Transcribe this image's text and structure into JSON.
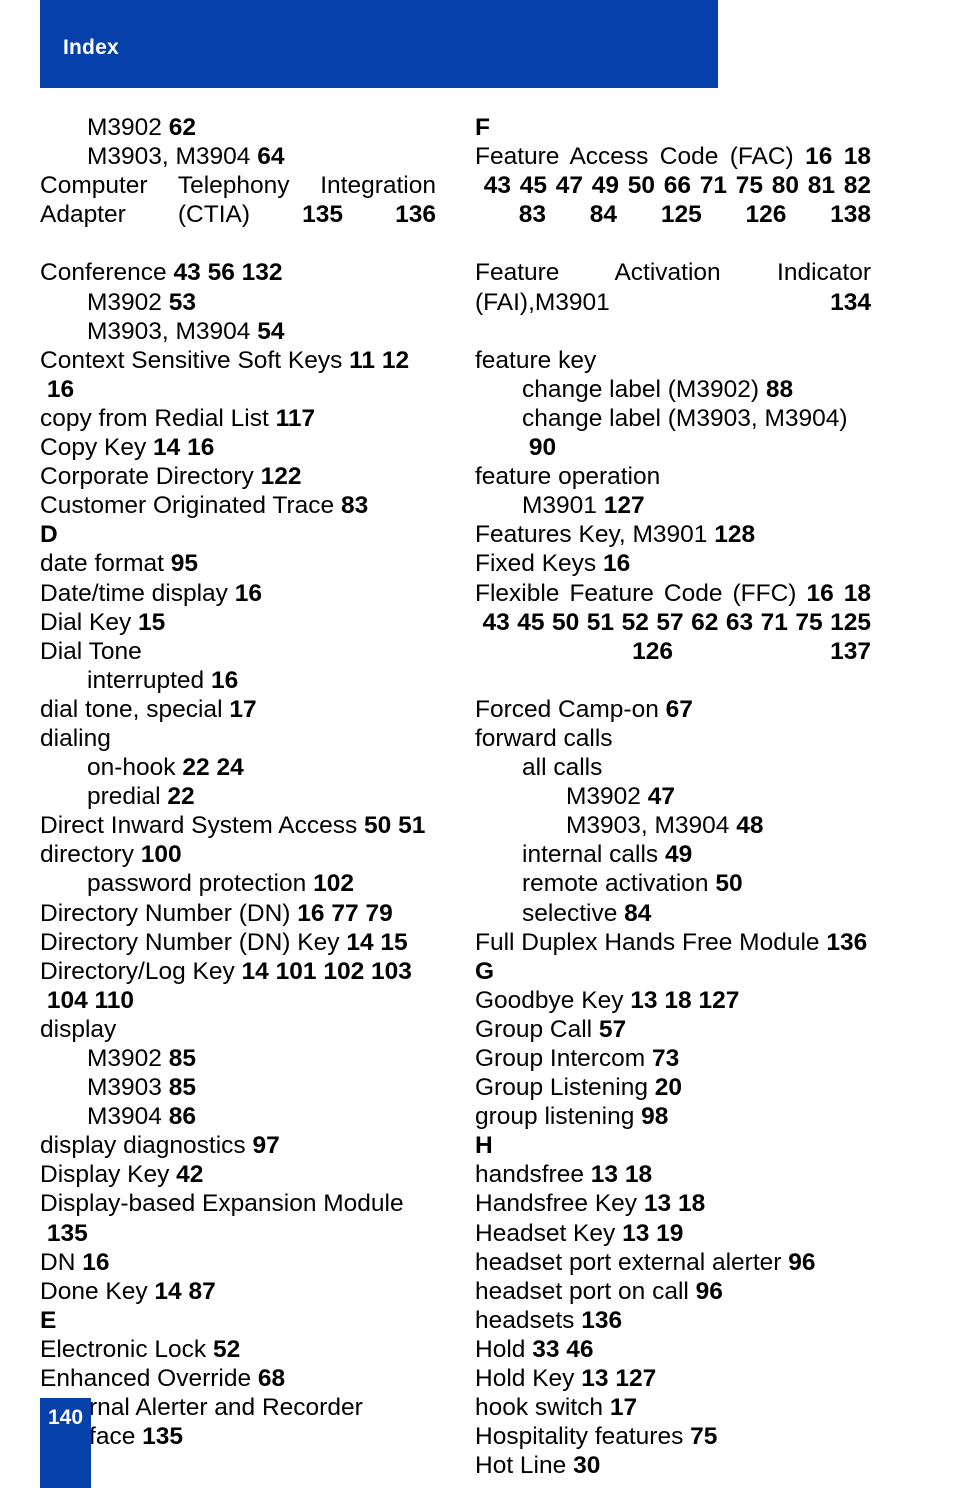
{
  "header": {
    "title": "Index",
    "band_color": "#0540ab"
  },
  "footer": {
    "page_number": "140",
    "box_color": "#0540ab"
  },
  "columns": [
    {
      "name": "left",
      "entries": [
        {
          "level": 1,
          "text": "M3902",
          "pages": [
            "62"
          ]
        },
        {
          "level": 1,
          "text": "M3903, M3904",
          "pages": [
            "64"
          ]
        },
        {
          "level": 0,
          "text": "Computer Telephony Integration Adapter (CTIA)",
          "pages": [
            "135",
            "136"
          ],
          "justify": true
        },
        {
          "level": 0,
          "text": "Conference",
          "pages": [
            "43",
            "56",
            "132"
          ]
        },
        {
          "level": 1,
          "text": "M3902",
          "pages": [
            "53"
          ]
        },
        {
          "level": 1,
          "text": "M3903, M3904",
          "pages": [
            "54"
          ]
        },
        {
          "level": 0,
          "text": "Context Sensitive Soft Keys",
          "pages": [
            "11",
            "12",
            "16"
          ]
        },
        {
          "level": 0,
          "text": "copy from Redial List",
          "pages": [
            "117"
          ]
        },
        {
          "level": 0,
          "text": "Copy Key",
          "pages": [
            "14",
            "16"
          ]
        },
        {
          "level": 0,
          "text": "Corporate Directory",
          "pages": [
            "122"
          ]
        },
        {
          "level": 0,
          "text": "Customer Originated Trace",
          "pages": [
            "83"
          ]
        },
        {
          "letter": "D"
        },
        {
          "level": 0,
          "text": "date format",
          "pages": [
            "95"
          ]
        },
        {
          "level": 0,
          "text": "Date/time display",
          "pages": [
            "16"
          ]
        },
        {
          "level": 0,
          "text": "Dial Key",
          "pages": [
            "15"
          ]
        },
        {
          "level": 0,
          "text": "Dial Tone",
          "pages": []
        },
        {
          "level": 1,
          "text": "interrupted",
          "pages": [
            "16"
          ]
        },
        {
          "level": 0,
          "text": "dial tone, special",
          "pages": [
            "17"
          ]
        },
        {
          "level": 0,
          "text": "dialing",
          "pages": []
        },
        {
          "level": 1,
          "text": "on-hook",
          "pages": [
            "22",
            "24"
          ]
        },
        {
          "level": 1,
          "text": "predial",
          "pages": [
            "22"
          ]
        },
        {
          "level": 0,
          "text": "Direct Inward System Access",
          "pages": [
            "50",
            "51"
          ]
        },
        {
          "level": 0,
          "text": "directory",
          "pages": [
            "100"
          ]
        },
        {
          "level": 1,
          "text": "password protection",
          "pages": [
            "102"
          ]
        },
        {
          "level": 0,
          "text": "Directory Number (DN)",
          "pages": [
            "16",
            "77",
            "79"
          ]
        },
        {
          "level": 0,
          "text": "Directory Number (DN) Key",
          "pages": [
            "14",
            "15"
          ]
        },
        {
          "level": 0,
          "text": "Directory/Log Key",
          "pages": [
            "14",
            "101",
            "102",
            "103",
            "104",
            "110"
          ]
        },
        {
          "level": 0,
          "text": "display",
          "pages": []
        },
        {
          "level": 1,
          "text": "M3902",
          "pages": [
            "85"
          ]
        },
        {
          "level": 1,
          "text": "M3903",
          "pages": [
            "85"
          ]
        },
        {
          "level": 1,
          "text": "M3904",
          "pages": [
            "86"
          ]
        },
        {
          "level": 0,
          "text": "display diagnostics",
          "pages": [
            "97"
          ]
        },
        {
          "level": 0,
          "text": "Display Key",
          "pages": [
            "42"
          ]
        },
        {
          "level": 0,
          "text": "Display-based Expansion Module",
          "pages": [
            "135"
          ]
        },
        {
          "level": 0,
          "text": "DN",
          "pages": [
            "16"
          ]
        },
        {
          "level": 0,
          "text": "Done Key",
          "pages": [
            "14",
            "87"
          ]
        },
        {
          "letter": "E"
        },
        {
          "level": 0,
          "text": "Electronic Lock",
          "pages": [
            "52"
          ]
        },
        {
          "level": 0,
          "text": "Enhanced Override",
          "pages": [
            "68"
          ]
        },
        {
          "level": 0,
          "text": "External Alerter and Recorder Interface",
          "pages": [
            "135"
          ]
        }
      ]
    },
    {
      "name": "right",
      "entries": [
        {
          "letter": "F"
        },
        {
          "level": 0,
          "text": "Feature Access Code (FAC)",
          "pages": [
            "16",
            "18",
            "43",
            "45",
            "47",
            "49",
            "50",
            "66",
            "71",
            "75",
            "80",
            "81",
            "82",
            "83",
            "84",
            "125",
            "126",
            "138"
          ],
          "justify": true
        },
        {
          "level": 0,
          "text": "Feature Activation Indicator (FAI),M3901",
          "pages": [
            "134"
          ],
          "justify": true
        },
        {
          "level": 0,
          "text": "feature key",
          "pages": []
        },
        {
          "level": 1,
          "text": "change label (M3902)",
          "pages": [
            "88"
          ]
        },
        {
          "level": 1,
          "text": "change label (M3903, M3904)",
          "pages": [
            "90"
          ]
        },
        {
          "level": 0,
          "text": "feature operation",
          "pages": []
        },
        {
          "level": 1,
          "text": "M3901",
          "pages": [
            "127"
          ]
        },
        {
          "level": 0,
          "text": "Features Key, M3901",
          "pages": [
            "128"
          ]
        },
        {
          "level": 0,
          "text": "Fixed Keys",
          "pages": [
            "16"
          ]
        },
        {
          "level": 0,
          "text": "Flexible Feature Code (FFC)",
          "pages": [
            "16",
            "18",
            "43",
            "45",
            "50",
            "51",
            "52",
            "57",
            "62",
            "63",
            "71",
            "75",
            "125",
            "126",
            "137"
          ],
          "justify": true
        },
        {
          "level": 0,
          "text": "Forced Camp-on",
          "pages": [
            "67"
          ]
        },
        {
          "level": 0,
          "text": "forward calls",
          "pages": []
        },
        {
          "level": 1,
          "text": "all calls",
          "pages": []
        },
        {
          "level": 2,
          "text": "M3902",
          "pages": [
            "47"
          ]
        },
        {
          "level": 2,
          "text": "M3903, M3904",
          "pages": [
            "48"
          ]
        },
        {
          "level": 1,
          "text": "internal calls",
          "pages": [
            "49"
          ]
        },
        {
          "level": 1,
          "text": "remote activation",
          "pages": [
            "50"
          ]
        },
        {
          "level": 1,
          "text": "selective",
          "pages": [
            "84"
          ]
        },
        {
          "level": 0,
          "text": "Full Duplex Hands Free Module",
          "pages": [
            "136"
          ]
        },
        {
          "letter": "G"
        },
        {
          "level": 0,
          "text": "Goodbye Key",
          "pages": [
            "13",
            "18",
            "127"
          ]
        },
        {
          "level": 0,
          "text": "Group Call",
          "pages": [
            "57"
          ]
        },
        {
          "level": 0,
          "text": "Group Intercom",
          "pages": [
            "73"
          ]
        },
        {
          "level": 0,
          "text": "Group Listening",
          "pages": [
            "20"
          ]
        },
        {
          "level": 0,
          "text": "group listening",
          "pages": [
            "98"
          ]
        },
        {
          "letter": "H"
        },
        {
          "level": 0,
          "text": "handsfree",
          "pages": [
            "13",
            "18"
          ]
        },
        {
          "level": 0,
          "text": "Handsfree Key",
          "pages": [
            "13",
            "18"
          ]
        },
        {
          "level": 0,
          "text": "Headset Key",
          "pages": [
            "13",
            "19"
          ]
        },
        {
          "level": 0,
          "text": "headset port external alerter",
          "pages": [
            "96"
          ]
        },
        {
          "level": 0,
          "text": "headset port on call",
          "pages": [
            "96"
          ]
        },
        {
          "level": 0,
          "text": "headsets",
          "pages": [
            "136"
          ]
        },
        {
          "level": 0,
          "text": "Hold",
          "pages": [
            "33",
            "46"
          ]
        },
        {
          "level": 0,
          "text": "Hold Key",
          "pages": [
            "13",
            "127"
          ]
        },
        {
          "level": 0,
          "text": "hook switch",
          "pages": [
            "17"
          ]
        },
        {
          "level": 0,
          "text": "Hospitality features",
          "pages": [
            "75"
          ]
        },
        {
          "level": 0,
          "text": "Hot Line",
          "pages": [
            "30"
          ]
        }
      ]
    }
  ]
}
